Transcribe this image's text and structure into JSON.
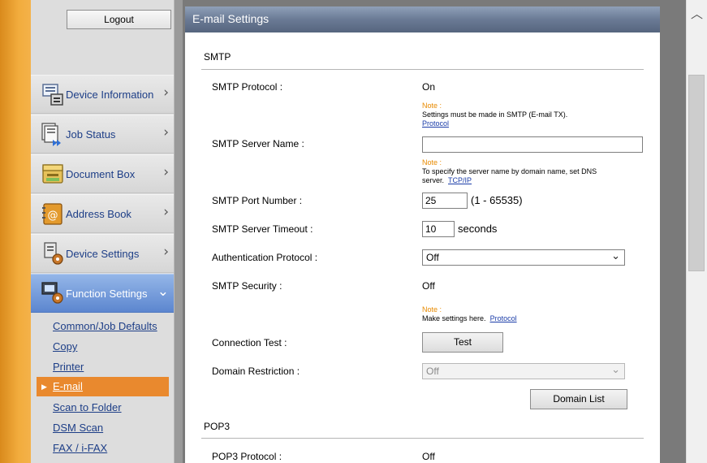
{
  "sidebar": {
    "logout_label": "Logout",
    "nav": [
      {
        "label": "Device Information",
        "icon": "device-information-icon"
      },
      {
        "label": "Job Status",
        "icon": "job-status-icon"
      },
      {
        "label": "Document Box",
        "icon": "document-box-icon"
      },
      {
        "label": "Address Book",
        "icon": "address-book-icon"
      },
      {
        "label": "Device Settings",
        "icon": "device-settings-icon"
      },
      {
        "label": "Function Settings",
        "icon": "function-settings-icon",
        "active": true
      }
    ],
    "sub_items": [
      {
        "label": "Common/Job Defaults"
      },
      {
        "label": "Copy"
      },
      {
        "label": "Printer"
      },
      {
        "label": "E-mail",
        "active": true
      },
      {
        "label": "Scan to Folder"
      },
      {
        "label": "DSM Scan"
      },
      {
        "label": "FAX / i-FAX"
      }
    ]
  },
  "panel": {
    "title": "E-mail Settings",
    "smtp": {
      "section_title": "SMTP",
      "protocol_label": "SMTP Protocol :",
      "protocol_value": "On",
      "protocol_note_head": "Note :",
      "protocol_note_text": "Settings must be made in SMTP (E-mail TX).",
      "protocol_note_link": "Protocol",
      "server_name_label": "SMTP Server Name :",
      "server_name_value": "",
      "server_note_head": "Note :",
      "server_note_text": "To specify the server name by domain name, set DNS server.",
      "server_note_link": "TCP/IP",
      "port_label": "SMTP Port Number :",
      "port_value": "25",
      "port_range": "(1 - 65535)",
      "timeout_label": "SMTP Server Timeout :",
      "timeout_value": "10",
      "timeout_unit": "seconds",
      "auth_label": "Authentication Protocol :",
      "auth_value": "Off",
      "security_label": "SMTP Security :",
      "security_value": "Off",
      "security_note_head": "Note :",
      "security_note_text": "Make settings here.",
      "security_note_link": "Protocol",
      "conn_test_label": "Connection Test :",
      "test_button": "Test",
      "domain_restriction_label": "Domain Restriction :",
      "domain_restriction_value": "Off",
      "domain_list_button": "Domain List"
    },
    "pop3": {
      "section_title": "POP3",
      "protocol_label": "POP3 Protocol :",
      "protocol_value": "Off"
    }
  },
  "colors": {
    "accent_orange": "#e9892e",
    "active_nav_blue": "#5c86cf",
    "link_blue": "#1d3e87",
    "note_orange": "#e88a00"
  }
}
